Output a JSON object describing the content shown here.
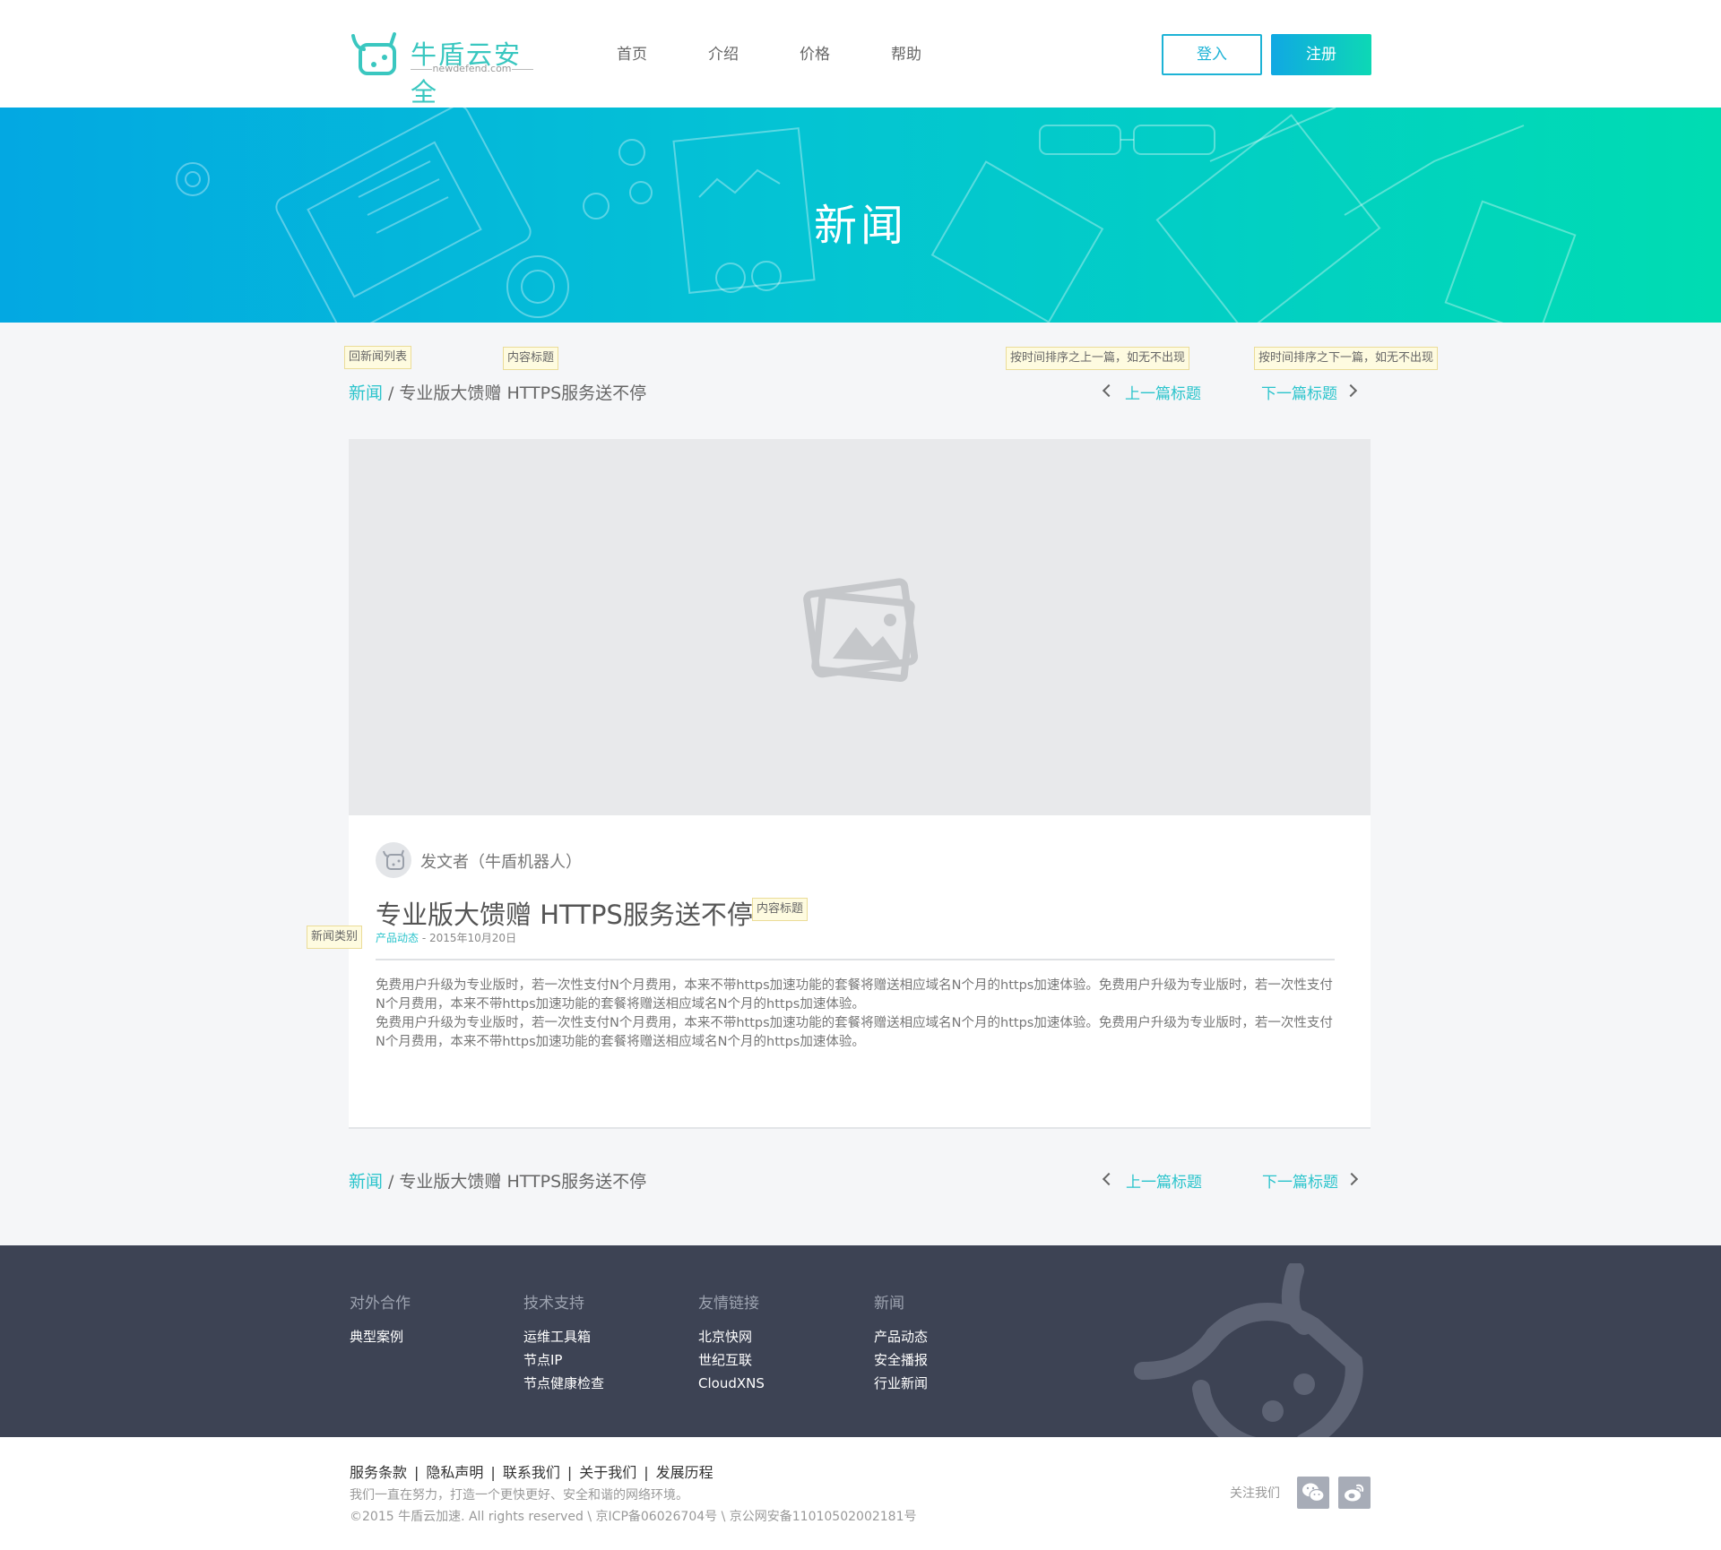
{
  "header": {
    "logo_text": "牛盾云安全",
    "logo_sub": "newdefend.com",
    "nav": [
      "首页",
      "介绍",
      "价格",
      "帮助"
    ],
    "login": "登入",
    "register": "注册"
  },
  "banner": {
    "title": "新闻"
  },
  "notes": {
    "back_to_list": "回新闻列表",
    "content_title": "内容标题",
    "prev_hint": "按时间排序之上一篇，如无不出现",
    "next_hint": "按时间排序之下一篇，如无不出现",
    "news_category": "新闻类别",
    "content_title_2": "内容标题"
  },
  "breadcrumb": {
    "home": "新闻",
    "separator": "/",
    "current": "专业版大馈赠 HTTPS服务送不停",
    "prev": "上一篇标题",
    "next": "下一篇标题"
  },
  "article": {
    "author": "发文者（牛盾机器人）",
    "title": "专业版大馈赠 HTTPS服务送不停",
    "category": "产品动态",
    "date": "- 2015年10月20日",
    "paragraphs": [
      "免费用户升级为专业版时，若一次性支付N个月费用，本来不带https加速功能的套餐将赠送相应域名N个月的https加速体验。免费用户升级为专业版时，若一次性支付N个月费用，本来不带https加速功能的套餐将赠送相应域名N个月的https加速体验。",
      "免费用户升级为专业版时，若一次性支付N个月费用，本来不带https加速功能的套餐将赠送相应域名N个月的https加速体验。免费用户升级为专业版时，若一次性支付N个月费用，本来不带https加速功能的套餐将赠送相应域名N个月的https加速体验。"
    ]
  },
  "footer": {
    "columns": [
      {
        "title": "对外合作",
        "links": [
          "典型案例"
        ]
      },
      {
        "title": "技术支持",
        "links": [
          "运维工具箱",
          "节点IP",
          "节点健康检查"
        ]
      },
      {
        "title": "友情链接",
        "links": [
          "北京快网",
          "世纪互联",
          "CloudXNS"
        ]
      },
      {
        "title": "新闻",
        "links": [
          "产品动态",
          "安全播报",
          "行业新闻"
        ]
      }
    ]
  },
  "bottom": {
    "links": [
      "服务条款",
      "隐私声明",
      "联系我们",
      "关于我们",
      "发展历程"
    ],
    "slogan": "我们一直在努力，打造一个更快更好、安全和谐的网络环境。",
    "copyright": "©2015 牛盾云加速. All rights reserved \\ 京ICP备06026704号 \\ 京公网安备11010502002181号",
    "follow": "关注我们",
    "social_icons": [
      "wechat-icon",
      "weibo-icon"
    ]
  },
  "colors": {
    "accent": "#2bc4cc",
    "banner_start": "#03a8e2",
    "banner_end": "#00dcb2",
    "footer_bg": "#3d4354"
  }
}
